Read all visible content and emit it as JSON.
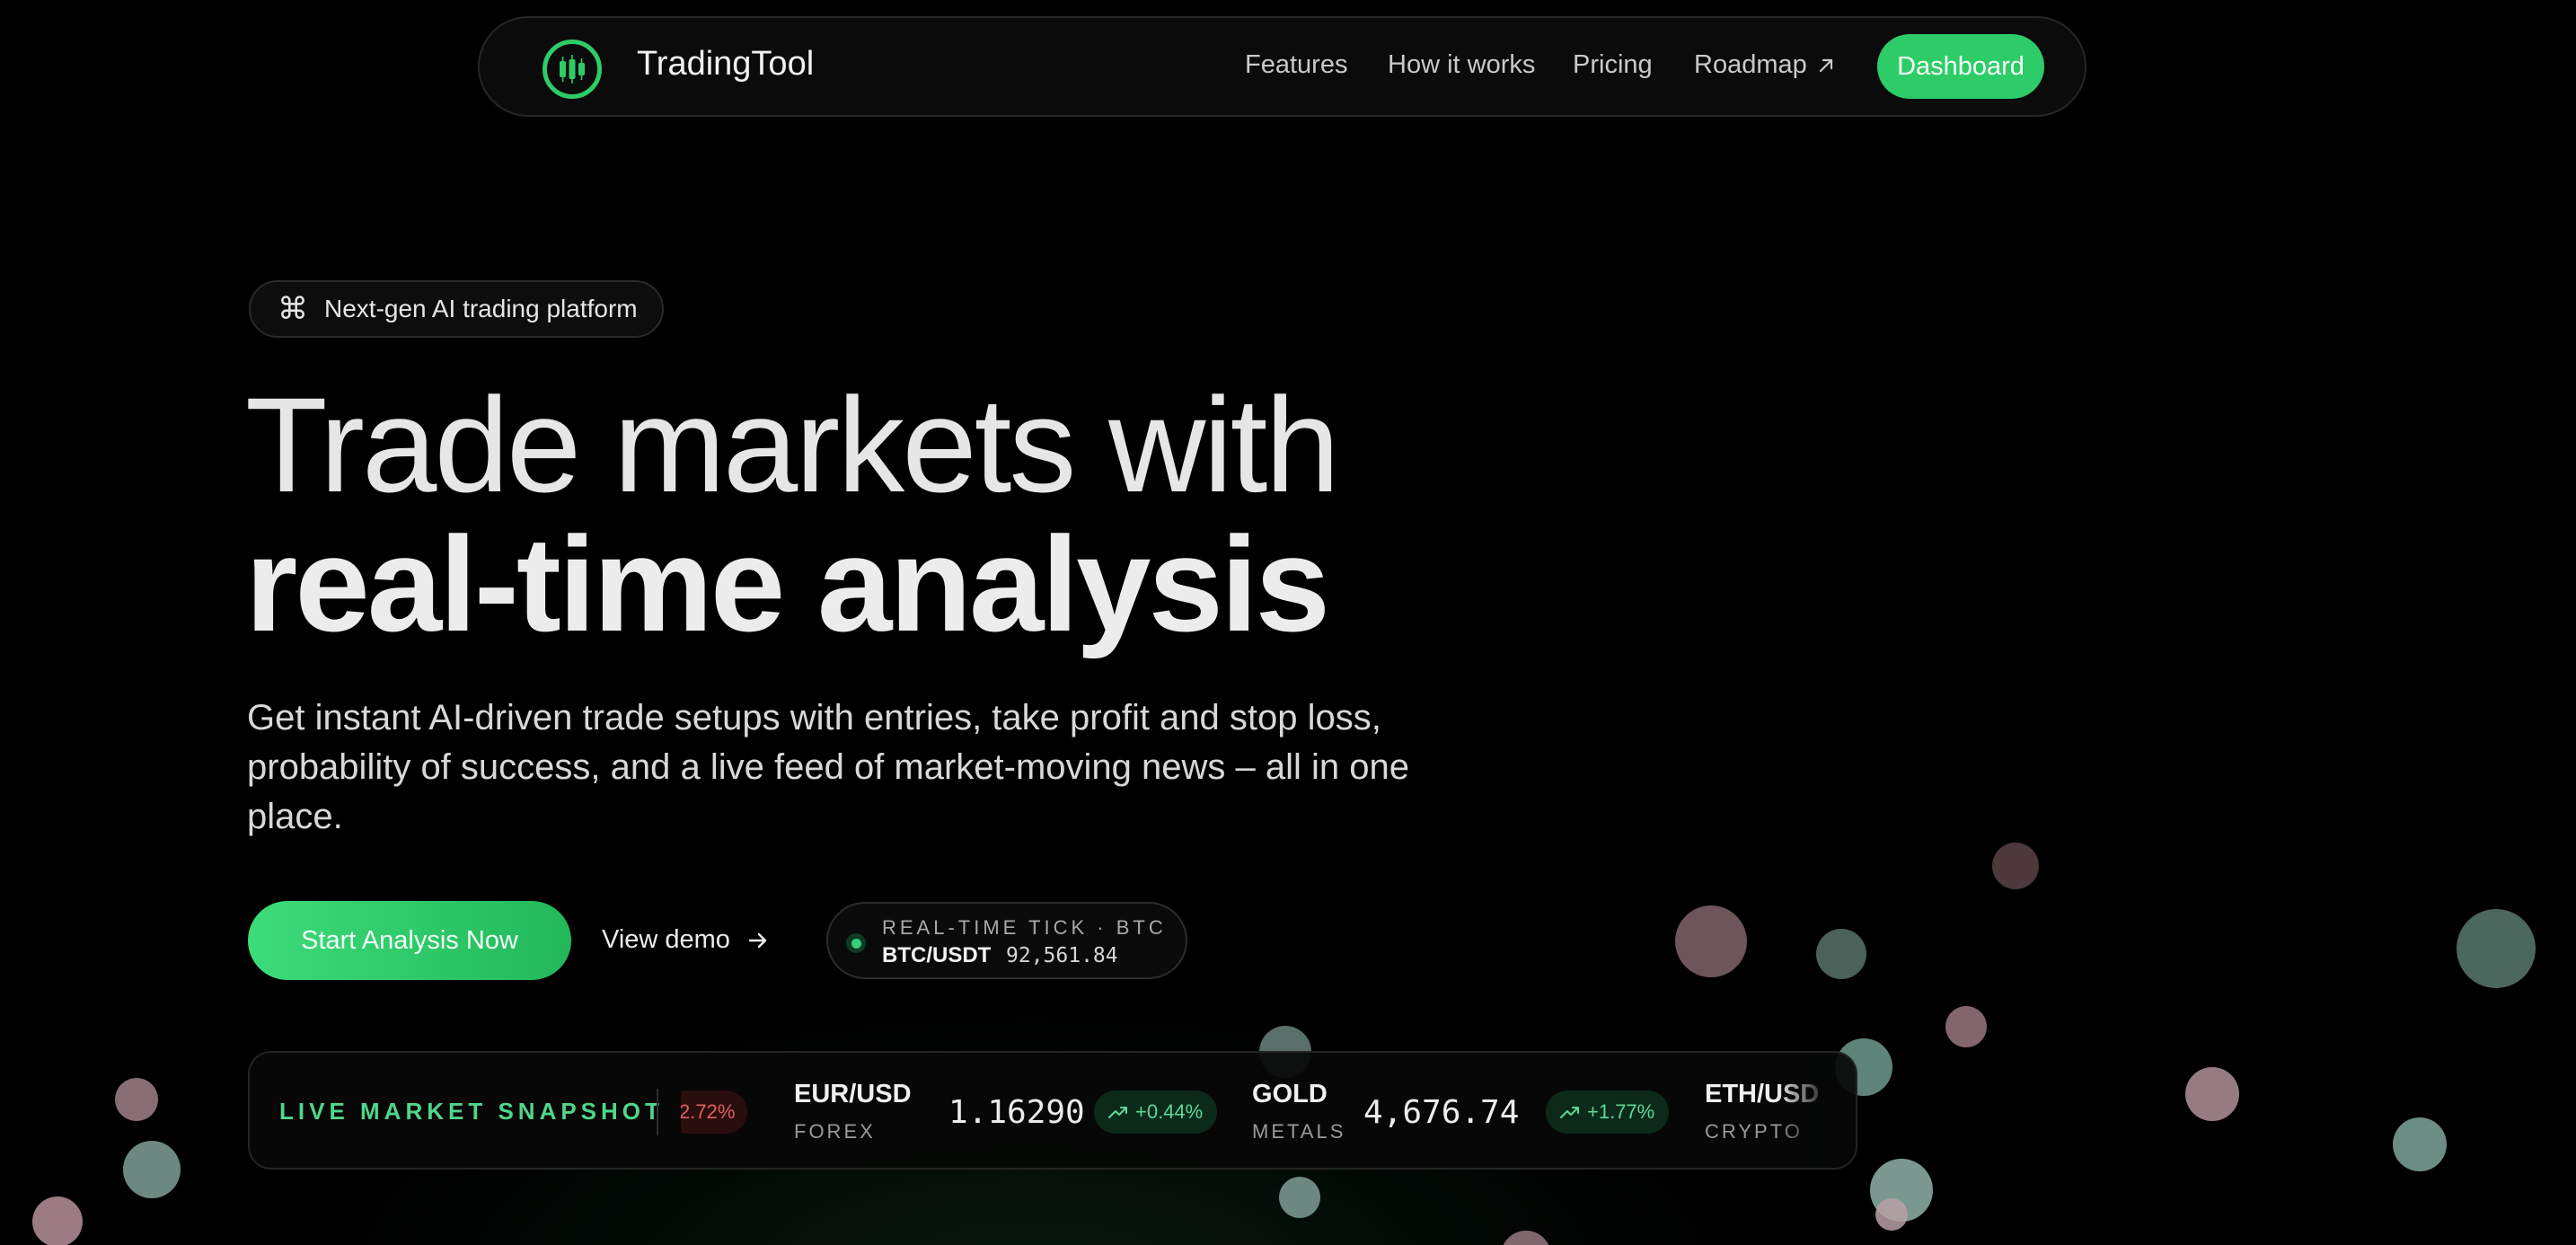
{
  "nav": {
    "brand": "TradingTool",
    "links": [
      "Features",
      "How it works",
      "Pricing",
      "Roadmap"
    ],
    "dashboard_label": "Dashboard"
  },
  "hero": {
    "badge": "Next-gen AI trading platform",
    "headline_line1": "Trade markets with",
    "headline_line2": "real-time analysis",
    "subtitle": "Get instant AI-driven trade setups with entries, take profit and stop loss, probability of success, and a live feed of market-moving news – all in one place.",
    "cta_label": "Start Analysis Now",
    "demo_label": "View demo"
  },
  "tick": {
    "label": "REAL-TIME TICK · BTC",
    "pair": "BTC/USDT",
    "price": "92,561.84"
  },
  "snapshot": {
    "title": "LIVE MARKET SNAPSHOT",
    "partial_change": "2.72%",
    "assets": [
      {
        "name": "EUR/USD",
        "category": "FOREX",
        "price": "1.16290",
        "change": "+0.44%"
      },
      {
        "name": "GOLD",
        "category": "METALS",
        "price": "4,676.74",
        "change": "+1.77%"
      },
      {
        "name": "ETH/USD",
        "category": "CRYPTO"
      }
    ]
  },
  "colors": {
    "accent": "#2ecc68",
    "background": "#000000",
    "positive": "#5fd895",
    "negative": "#e06060"
  }
}
